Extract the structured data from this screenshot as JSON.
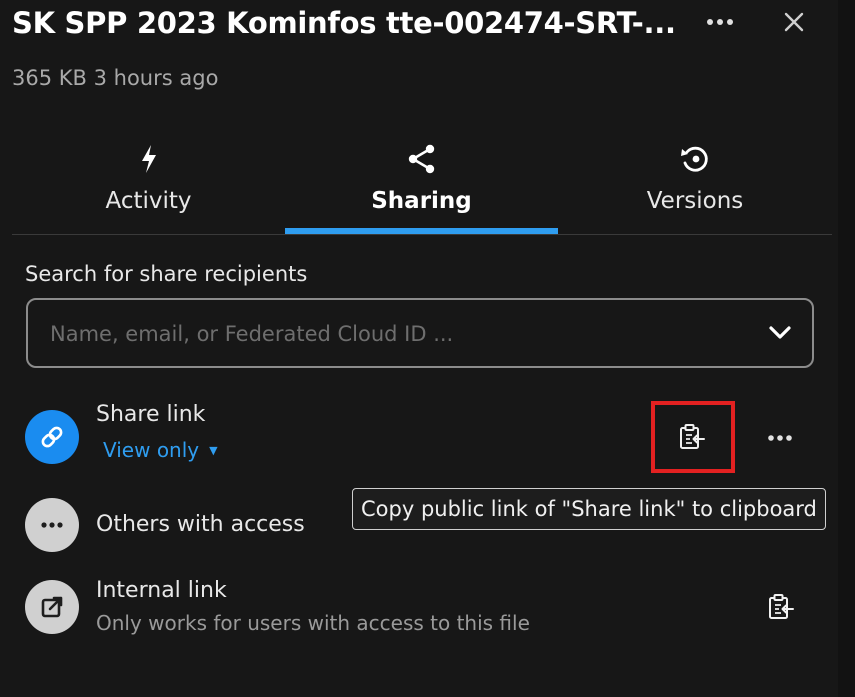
{
  "header": {
    "file_title": "SK SPP 2023 Kominfos tte-002474-SRT-...",
    "meta": "365 KB 3 hours ago"
  },
  "tabs": [
    {
      "label": "Activity",
      "icon": "lightning-icon",
      "active": false
    },
    {
      "label": "Sharing",
      "icon": "share-icon",
      "active": true
    },
    {
      "label": "Versions",
      "icon": "history-icon",
      "active": false
    }
  ],
  "search": {
    "label": "Search for share recipients",
    "placeholder": "Name, email, or Federated Cloud ID ..."
  },
  "shares": {
    "share_link": {
      "title": "Share link",
      "permission": "View only"
    },
    "others": {
      "title": "Others with access"
    },
    "internal": {
      "title": "Internal link",
      "subtitle": "Only works for users with access to this file"
    }
  },
  "tooltip": "Copy public link of \"Share link\" to clipboard",
  "colors": {
    "background": "#171717",
    "accent": "#2f9df0",
    "highlight": "#e32121",
    "avatar_grey": "#d0d0d0"
  }
}
